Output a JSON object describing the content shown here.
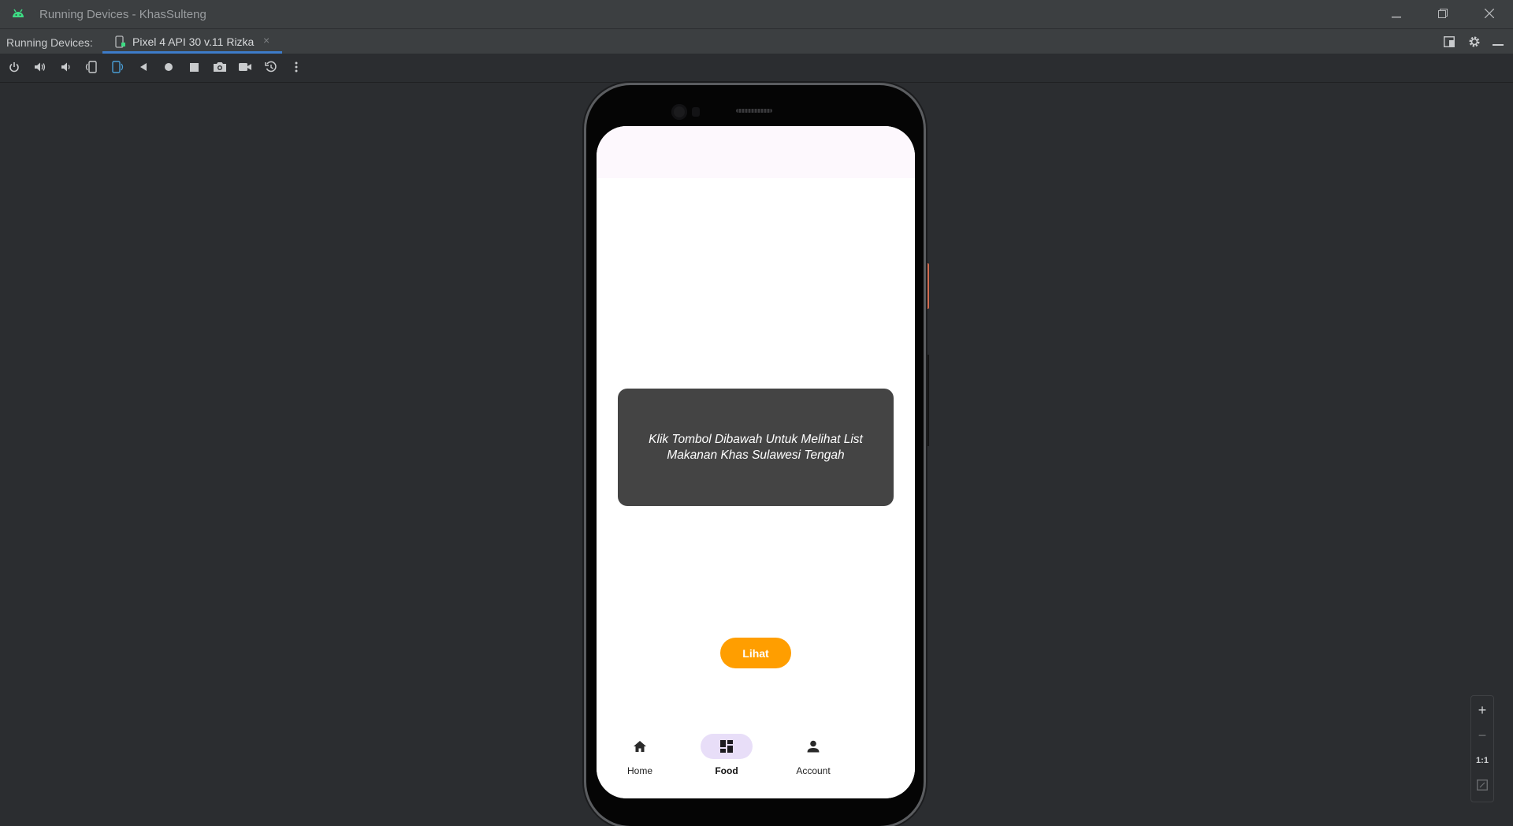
{
  "window": {
    "title": "Running Devices - KhasSulteng",
    "minimize_icon": "minimize-icon",
    "restore_icon": "restore-icon",
    "close_icon": "close-icon"
  },
  "tabs": {
    "panel_label": "Running Devices:",
    "active_tab": {
      "label": "Pixel 4 API 30 v.11 Rizka",
      "close_glyph": "×"
    }
  },
  "toolbar": {
    "tools": [
      "power-icon",
      "volume-up-icon",
      "volume-down-icon",
      "rotate-left-icon",
      "rotate-right-icon",
      "back-icon",
      "home-icon",
      "overview-icon",
      "screenshot-icon",
      "screen-record-icon",
      "snapshot-icon",
      "more-icon"
    ]
  },
  "device": {
    "card_text": "Klik Tombol Dibawah Untuk Melihat List Makanan Khas Sulawesi Tengah",
    "button_label": "Lihat",
    "nav": [
      {
        "label": "Home",
        "icon": "home-icon",
        "active": false
      },
      {
        "label": "Food",
        "icon": "dashboard-icon",
        "active": true
      },
      {
        "label": "Account",
        "icon": "person-icon",
        "active": false
      }
    ]
  },
  "zoom": {
    "zoom_in": "+",
    "zoom_out": "−",
    "actual_size": "1:1"
  },
  "colors": {
    "accent_orange": "#ff9e00",
    "card_bg": "#444444",
    "nav_active_pill": "#e8def8",
    "tab_underline": "#3d7cc9"
  }
}
